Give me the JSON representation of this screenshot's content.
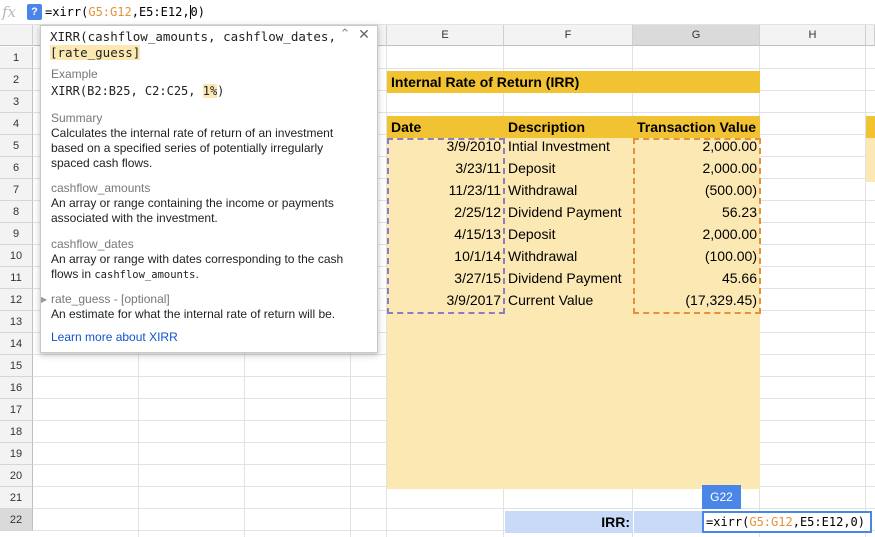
{
  "formula_bar": {
    "fx": "fx",
    "help": "?",
    "formula": {
      "prefix": "=xirr(",
      "range1": "G5:G12",
      "sep1": ",",
      "range2": "E5:E12",
      "sep2": ",",
      "arg": "0",
      "suffix": ")"
    }
  },
  "columns": [
    "E",
    "F",
    "G",
    "H"
  ],
  "rows": [
    "1",
    "2",
    "3",
    "4",
    "5",
    "6",
    "7",
    "8",
    "9",
    "10",
    "11",
    "12",
    "13",
    "14",
    "15",
    "16",
    "17",
    "18",
    "19",
    "20",
    "21",
    "22"
  ],
  "sheet": {
    "title": "Internal Rate of Return (IRR)",
    "headers": {
      "date": "Date",
      "description": "Description",
      "value": "Transaction Value"
    },
    "data": [
      {
        "date": "3/9/2010",
        "description": "Intial Investment",
        "value": "2,000.00"
      },
      {
        "date": "3/23/11",
        "description": "Deposit",
        "value": "2,000.00"
      },
      {
        "date": "11/23/11",
        "description": "Withdrawal",
        "value": "(500.00)"
      },
      {
        "date": "2/25/12",
        "description": "Dividend Payment",
        "value": "56.23"
      },
      {
        "date": "4/15/13",
        "description": "Deposit",
        "value": "2,000.00"
      },
      {
        "date": "10/1/14",
        "description": "Withdrawal",
        "value": "(100.00)"
      },
      {
        "date": "3/27/15",
        "description": "Dividend Payment",
        "value": "45.66"
      },
      {
        "date": "3/9/2017",
        "description": "Current Value",
        "value": "(17,329.45)"
      }
    ],
    "irr_label": "IRR:"
  },
  "active_cell": {
    "ref": "G22",
    "editor": {
      "prefix": "=xirr(",
      "range1": "G5:G12",
      "sep1": ",",
      "range2": "E5:E12",
      "sep2": ",0)"
    }
  },
  "tooltip": {
    "signature": {
      "fn": "XIRR(cashflow_amounts, cashflow_dates,",
      "opt": "[rate_guess]"
    },
    "example_label": "Example",
    "example": {
      "pre": "XIRR(B2:B25, C2:C25, ",
      "hl": "1%",
      "post": ")"
    },
    "summary_label": "Summary",
    "summary": "Calculates the internal rate of return of an investment based on a specified series of potentially irregularly spaced cash flows.",
    "params": [
      {
        "name": "cashflow_amounts",
        "desc": "An array or range containing the income or payments associated with the investment."
      },
      {
        "name": "cashflow_dates",
        "desc_pre": "An array or range with dates corresponding to the cash flows in ",
        "desc_code": "cashflow_amounts",
        "desc_post": "."
      },
      {
        "name": "rate_guess - [optional]",
        "desc": "An estimate for what the internal rate of return will be."
      }
    ],
    "learn_more": "Learn more about XIRR"
  },
  "colors": {
    "accent": "#4a86e8",
    "header_fill": "#f1c232",
    "table_fill": "#fce8b2",
    "range_orange": "#e69138",
    "range_purple": "#8e7cc3"
  }
}
